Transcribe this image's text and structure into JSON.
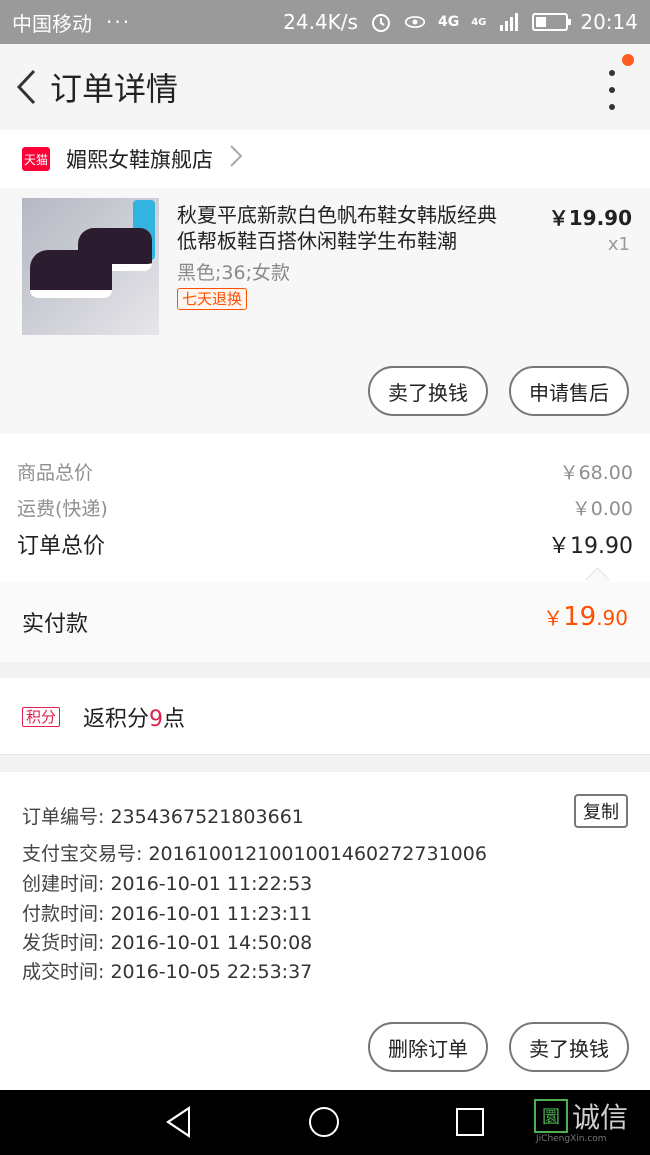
{
  "status_bar": {
    "carrier": "中国移动",
    "dots": "···",
    "speed": "24.4K/s",
    "net1": "4G",
    "net2": "4G",
    "time": "20:14"
  },
  "header": {
    "title": "订单详情"
  },
  "shop": {
    "badge": "天猫",
    "name": "媚熙女鞋旗舰店"
  },
  "product": {
    "title": "秋夏平底新款白色帆布鞋女韩版经典低帮板鞋百搭休闲鞋学生布鞋潮",
    "sku": "黑色;36;女款",
    "tag": "七天退换",
    "price": "￥19.90",
    "qty": "x1",
    "buttons": {
      "sell": "卖了换钱",
      "after_sale": "申请售后"
    }
  },
  "totals": {
    "goods_label": "商品总价",
    "goods_value": "￥68.00",
    "shipping_label": "运费(快递)",
    "shipping_value": "￥0.00",
    "order_label": "订单总价",
    "order_value": "￥19.90"
  },
  "paid": {
    "label": "实付款",
    "currency": "￥",
    "integer": "19",
    "decimal": ".90"
  },
  "points": {
    "badge": "积分",
    "prefix": "返积分",
    "number": "9",
    "suffix": "点"
  },
  "info": {
    "copy_label": "复制",
    "rows": [
      {
        "k": "订单编号:",
        "v": "2354367521803661"
      },
      {
        "k": "支付宝交易号:",
        "v": "2016100121001001460272731006"
      },
      {
        "k": "创建时间:",
        "v": "2016-10-01 11:22:53"
      },
      {
        "k": "付款时间:",
        "v": "2016-10-01 11:23:11"
      },
      {
        "k": "发货时间:",
        "v": "2016-10-01 14:50:08"
      },
      {
        "k": "成交时间:",
        "v": "2016-10-05 22:53:37"
      }
    ]
  },
  "actions": {
    "delete": "删除订单",
    "sell": "卖了换钱"
  },
  "watermark": {
    "mark": "圜",
    "text": "诚信",
    "sub": "JiChengXin.com"
  },
  "colors": {
    "accent": "#ff5000",
    "points": "#e0204f",
    "tmall": "#ff0036"
  }
}
